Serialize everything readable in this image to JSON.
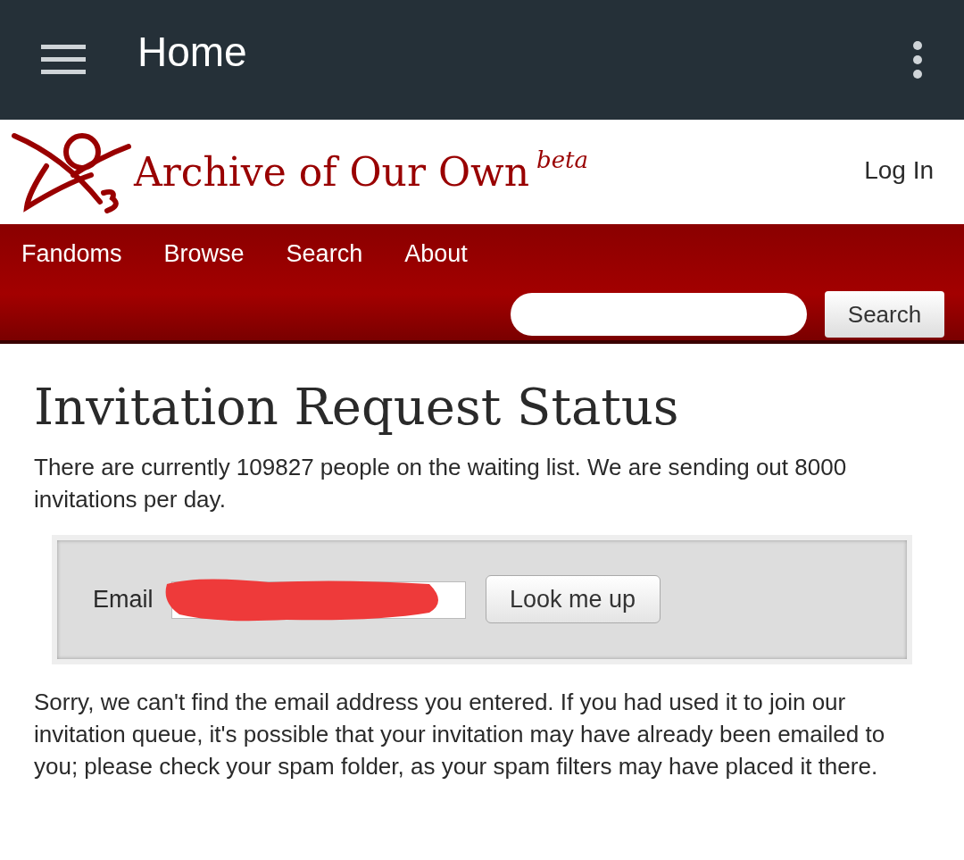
{
  "app_bar": {
    "title": "Home"
  },
  "site_header": {
    "title": "Archive of Our Own",
    "badge": "beta",
    "login": "Log In"
  },
  "nav": {
    "items": [
      "Fandoms",
      "Browse",
      "Search",
      "About"
    ],
    "search_button": "Search"
  },
  "page": {
    "heading": "Invitation Request Status",
    "intro": "There are currently 109827 people on the waiting list. We are sending out 8000 invitations per day.",
    "form": {
      "label": "Email",
      "button": "Look me up",
      "redacted": true
    },
    "message": "Sorry, we can't find the email address you entered. If you had used it to join our invitation queue, it's possible that your invitation may have already been emailed to you; please check your spam folder, as your spam filters may have placed it there."
  }
}
